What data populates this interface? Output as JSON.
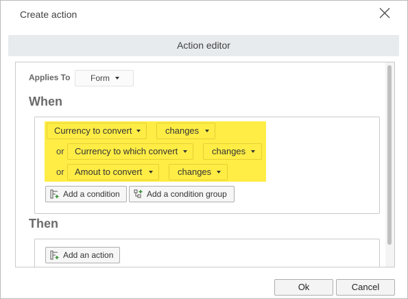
{
  "dialog": {
    "title": "Create action"
  },
  "section": {
    "title": "Action editor"
  },
  "applies": {
    "label": "Applies To",
    "value": "Form"
  },
  "when": {
    "heading": "When",
    "conditions": [
      {
        "connector": "",
        "field": "Currency to convert",
        "operator": "changes"
      },
      {
        "connector": "or",
        "field": "Currency to which convert",
        "operator": "changes"
      },
      {
        "connector": "or",
        "field": "Amout to convert",
        "operator": "changes"
      }
    ],
    "add_condition": "Add a condition",
    "add_condition_group": "Add a condition group",
    "highlight_color": "#ffed45"
  },
  "then": {
    "heading": "Then",
    "add_action": "Add an action"
  },
  "footer": {
    "ok": "Ok",
    "cancel": "Cancel"
  }
}
